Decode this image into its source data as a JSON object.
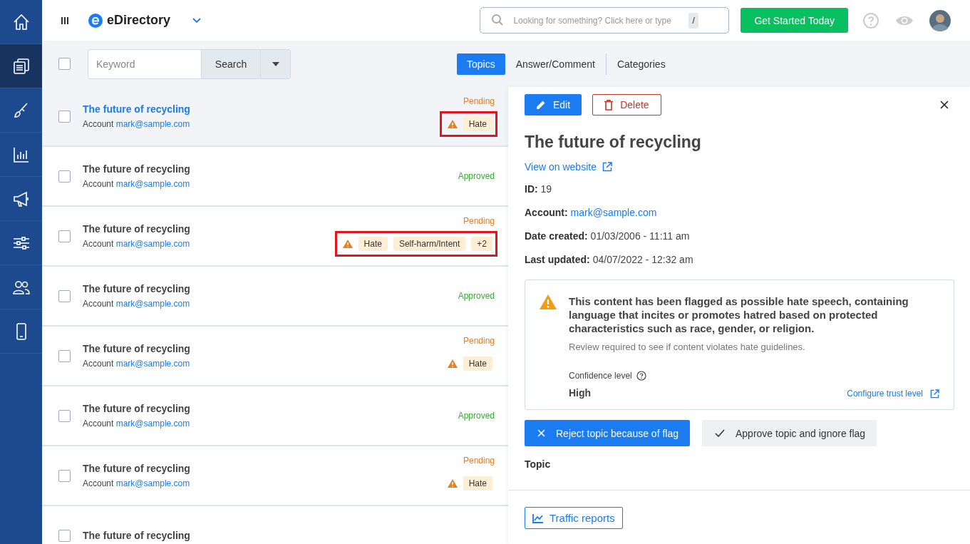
{
  "header": {
    "brand": "eDirectory",
    "search_placeholder": "Looking for something? Click here or type",
    "search_key": "/",
    "cta": "Get Started Today"
  },
  "sidebar": {
    "items": [
      {
        "kind": "home",
        "selected": false
      },
      {
        "kind": "pages",
        "selected": true
      },
      {
        "kind": "brush",
        "selected": false
      },
      {
        "kind": "chart",
        "selected": false
      },
      {
        "kind": "megaphone",
        "selected": false
      },
      {
        "kind": "sliders",
        "selected": false
      },
      {
        "kind": "users",
        "selected": false
      },
      {
        "kind": "phone",
        "selected": false
      }
    ]
  },
  "toolbar": {
    "select_all_checked": false,
    "keyword_placeholder": "Keyword",
    "search_button": "Search",
    "tabs": [
      {
        "label": "Topics",
        "selected": true
      },
      {
        "label": "Answer/Comment",
        "selected": false
      },
      {
        "label": "Categories",
        "selected": false
      }
    ]
  },
  "rows": [
    {
      "title": "The future of recycling",
      "account_label": "Account",
      "account": "mark@sample.com",
      "status": "Pending",
      "color": "#e67e22",
      "flags": [
        "Hate"
      ],
      "highlighted": true,
      "active": true,
      "checked": false
    },
    {
      "title": "The future of recycling",
      "account_label": "Account",
      "account": "mark@sample.com",
      "status": "Approved",
      "color": "#3aaa35",
      "flags": [],
      "active": false,
      "checked": false
    },
    {
      "title": "The future of recycling",
      "account_label": "Account",
      "account": "mark@sample.com",
      "status": "Pending",
      "color": "#e67e22",
      "flags": [
        "Hate",
        "Self-harm/Intent",
        "+2"
      ],
      "highlighted": true,
      "active": false,
      "checked": false
    },
    {
      "title": "The future of recycling",
      "account_label": "Account",
      "account": "mark@sample.com",
      "status": "Approved",
      "color": "#3aaa35",
      "flags": [],
      "active": false,
      "checked": false
    },
    {
      "title": "The future of recycling",
      "account_label": "Account",
      "account": "mark@sample.com",
      "status": "Pending",
      "color": "#e67e22",
      "flags": [
        "Hate"
      ],
      "highlighted": false,
      "active": false,
      "checked": false
    },
    {
      "title": "The future of recycling",
      "account_label": "Account",
      "account": "mark@sample.com",
      "status": "Approved",
      "color": "#3aaa35",
      "flags": [],
      "active": false,
      "checked": false
    },
    {
      "title": "The future of recycling",
      "account_label": "Account",
      "account": "mark@sample.com",
      "status": "Pending",
      "color": "#e67e22",
      "flags": [
        "Hate"
      ],
      "highlighted": false,
      "active": false,
      "checked": false
    },
    {
      "title": "The future of recycling",
      "checked": false
    }
  ],
  "detail": {
    "edit": "Edit",
    "delete": "Delete",
    "title": "The future of recycling",
    "view_link": "View on website",
    "fields": [
      {
        "label": "ID:",
        "value": "19",
        "kind": "text"
      },
      {
        "label": "Account:",
        "value": "mark@sample.com",
        "kind": "link"
      },
      {
        "label": "Date created:",
        "value": "01/03/2006 - 11:11 am",
        "kind": "text"
      },
      {
        "label": "Last updated:",
        "value": "04/07/2022 - 12:32 am",
        "kind": "text"
      }
    ],
    "flag": {
      "message": "This content has been flagged as possible hate speech, containing language that incites or promotes hatred based on protected characteristics such as race, gender, or religion.",
      "note": "Review required to see if content violates hate guidelines.",
      "confidence_label": "Confidence level",
      "confidence_value": "High",
      "configure_link": "Configure trust level"
    },
    "reject": "Reject topic because of flag",
    "approve": "Approve topic and ignore flag",
    "section": "Topic",
    "footer_button": "Traffic reports"
  }
}
